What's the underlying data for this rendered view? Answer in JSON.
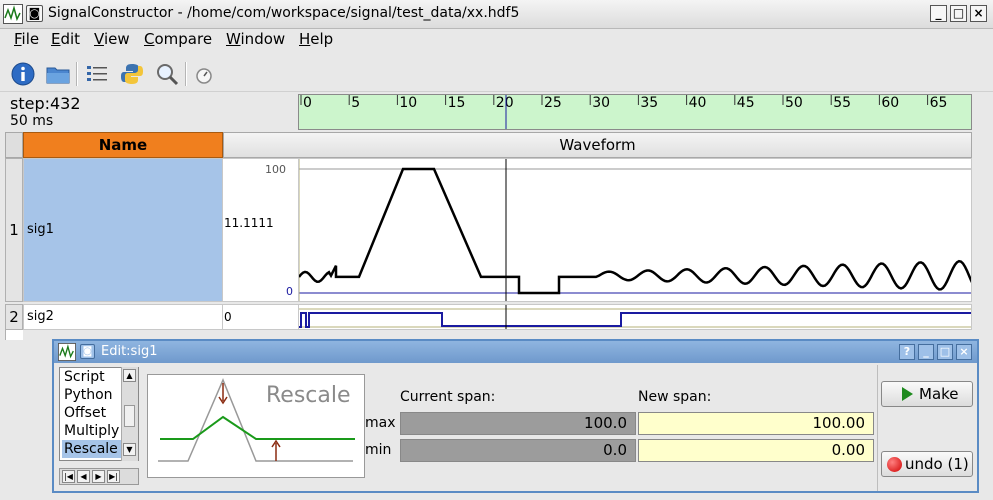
{
  "window": {
    "title": "SignalConstructor - /home/com/workspace/signal/test_data/xx.hdf5"
  },
  "menu": [
    "File",
    "Edit",
    "View",
    "Compare",
    "Window",
    "Help"
  ],
  "menu_mnemonic": [
    "F",
    "E",
    "V",
    "C",
    "W",
    "H"
  ],
  "toolbar": {
    "icons": [
      "info-icon",
      "open-folder-icon",
      "list-icon",
      "python-icon",
      "search-icon",
      "timer-icon"
    ]
  },
  "status": {
    "step": "step:432",
    "time": "50 ms"
  },
  "ruler": {
    "ticks": [
      "0",
      "5",
      "10",
      "15",
      "20",
      "25",
      "30",
      "35",
      "40",
      "45",
      "50",
      "55",
      "60",
      "65"
    ],
    "cursor": 432
  },
  "grid": {
    "headers": {
      "name": "Name",
      "waveform": "Waveform"
    },
    "rows": [
      {
        "num": "1",
        "name": "sig1",
        "value": "11.1111",
        "axis_top": "100",
        "axis_bottom": "0"
      },
      {
        "num": "2",
        "name": "sig2",
        "value": "0"
      }
    ]
  },
  "dialog": {
    "title": "Edit:sig1",
    "buttons": [
      "?",
      "_",
      "□",
      "×"
    ],
    "list": [
      "Script",
      "Python",
      "Offset",
      "Multiply",
      "Rescale"
    ],
    "selected": "Rescale",
    "preview_label": "Rescale",
    "current_span_label": "Current span:",
    "new_span_label": "New span:",
    "max_label": "max",
    "min_label": "min",
    "current_max": "100.0",
    "current_min": "0.0",
    "new_max": "100.00",
    "new_min": "0.00",
    "make_label": "Make",
    "undo_label": "undo (1)"
  },
  "colors": {
    "selection": "#a6c4e8",
    "header_name": "#f07f1e",
    "ruler_bg": "#ccf5cc",
    "dialog_title": "#6f99cc",
    "signal_blue": "#1a1aa0"
  }
}
